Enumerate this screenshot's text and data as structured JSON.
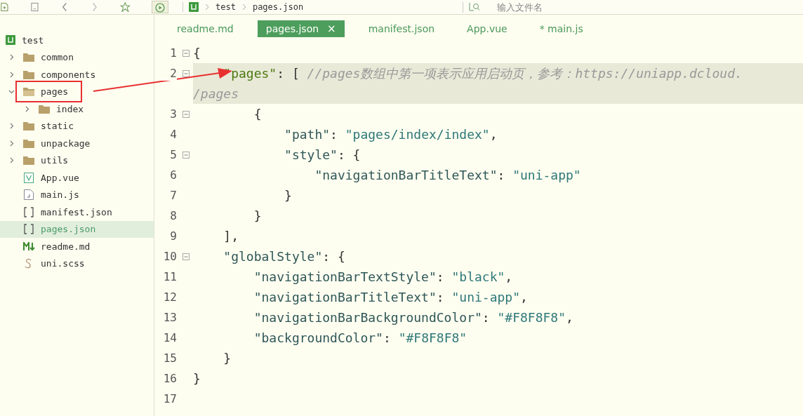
{
  "toolbar": {
    "breadcrumb": [
      "test",
      "pages.json"
    ],
    "search": {
      "placeholder": "输入文件名"
    }
  },
  "project": {
    "name": "test",
    "children": [
      {
        "name": "common",
        "kind": "folder",
        "expanded": false
      },
      {
        "name": "components",
        "kind": "folder",
        "expanded": false
      },
      {
        "name": "pages",
        "kind": "folder",
        "expanded": true,
        "highlighted": true,
        "children": [
          {
            "name": "index",
            "kind": "folder",
            "expanded": false
          }
        ]
      },
      {
        "name": "static",
        "kind": "folder",
        "expanded": false
      },
      {
        "name": "unpackage",
        "kind": "folder",
        "expanded": false
      },
      {
        "name": "utils",
        "kind": "folder",
        "expanded": false
      },
      {
        "name": "App.vue",
        "kind": "vue",
        "selected": false
      },
      {
        "name": "main.js",
        "kind": "js",
        "selected": false
      },
      {
        "name": "manifest.json",
        "kind": "json",
        "selected": false
      },
      {
        "name": "pages.json",
        "kind": "json",
        "selected": true
      },
      {
        "name": "readme.md",
        "kind": "md",
        "selected": false
      },
      {
        "name": "uni.scss",
        "kind": "scss",
        "selected": false
      }
    ]
  },
  "tabs": [
    {
      "label": "readme.md",
      "selected": false
    },
    {
      "label": "pages.json",
      "selected": true,
      "close": "×"
    },
    {
      "label": "manifest.json",
      "selected": false
    },
    {
      "label": "App.vue",
      "selected": false
    },
    {
      "label": "* main.js",
      "selected": false
    }
  ],
  "code": [
    {
      "number": "1",
      "fold": true,
      "current": false,
      "tokens": [
        {
          "kind": "punct",
          "text": "{"
        }
      ]
    },
    {
      "number": "2",
      "fold": true,
      "current": true,
      "tokens": [
        {
          "kind": "mainkey",
          "text": "    \"pages\""
        },
        {
          "kind": "punct",
          "text": ": [ "
        },
        {
          "kind": "comment",
          "text": "//pages数组中第一项表示应用启动页，参考：https://uniapp.dcloud."
        }
      ],
      "wrap": [
        {
          "kind": "comment",
          "text": "/pages"
        }
      ]
    },
    {
      "number": "3",
      "fold": true,
      "current": false,
      "tokens": [
        {
          "kind": "punct",
          "text": "        {"
        }
      ]
    },
    {
      "number": "4",
      "fold": false,
      "current": false,
      "tokens": [
        {
          "kind": "key",
          "text": "            \"path\""
        },
        {
          "kind": "punct",
          "text": ": "
        },
        {
          "kind": "string",
          "text": "\"pages/index/index\""
        },
        {
          "kind": "punct",
          "text": ","
        }
      ]
    },
    {
      "number": "5",
      "fold": true,
      "current": false,
      "tokens": [
        {
          "kind": "key",
          "text": "            \"style\""
        },
        {
          "kind": "punct",
          "text": ": {"
        }
      ]
    },
    {
      "number": "6",
      "fold": false,
      "current": false,
      "tokens": [
        {
          "kind": "key",
          "text": "                \"navigationBarTitleText\""
        },
        {
          "kind": "punct",
          "text": ": "
        },
        {
          "kind": "string",
          "text": "\"uni-app\""
        }
      ]
    },
    {
      "number": "7",
      "fold": false,
      "current": false,
      "tokens": [
        {
          "kind": "punct",
          "text": "            }"
        }
      ]
    },
    {
      "number": "8",
      "fold": false,
      "current": false,
      "tokens": [
        {
          "kind": "punct",
          "text": "        }"
        }
      ]
    },
    {
      "number": "9",
      "fold": false,
      "current": false,
      "tokens": [
        {
          "kind": "punct",
          "text": "    ],"
        }
      ]
    },
    {
      "number": "10",
      "fold": true,
      "current": false,
      "tokens": [
        {
          "kind": "key",
          "text": "    \"globalStyle\""
        },
        {
          "kind": "punct",
          "text": ": {"
        }
      ]
    },
    {
      "number": "11",
      "fold": false,
      "current": false,
      "tokens": [
        {
          "kind": "key",
          "text": "        \"navigationBarTextStyle\""
        },
        {
          "kind": "punct",
          "text": ": "
        },
        {
          "kind": "string",
          "text": "\"black\""
        },
        {
          "kind": "punct",
          "text": ","
        }
      ]
    },
    {
      "number": "12",
      "fold": false,
      "current": false,
      "tokens": [
        {
          "kind": "key",
          "text": "        \"navigationBarTitleText\""
        },
        {
          "kind": "punct",
          "text": ": "
        },
        {
          "kind": "string",
          "text": "\"uni-app\""
        },
        {
          "kind": "punct",
          "text": ","
        }
      ]
    },
    {
      "number": "13",
      "fold": false,
      "current": false,
      "tokens": [
        {
          "kind": "key",
          "text": "        \"navigationBarBackgroundColor\""
        },
        {
          "kind": "punct",
          "text": ": "
        },
        {
          "kind": "string",
          "text": "\"#F8F8F8\""
        },
        {
          "kind": "punct",
          "text": ","
        }
      ]
    },
    {
      "number": "14",
      "fold": false,
      "current": false,
      "tokens": [
        {
          "kind": "key",
          "text": "        \"backgroundColor\""
        },
        {
          "kind": "punct",
          "text": ": "
        },
        {
          "kind": "string",
          "text": "\"#F8F8F8\""
        }
      ]
    },
    {
      "number": "15",
      "fold": false,
      "current": false,
      "tokens": [
        {
          "kind": "punct",
          "text": "    }"
        }
      ]
    },
    {
      "number": "16",
      "fold": false,
      "current": false,
      "tokens": [
        {
          "kind": "punct",
          "text": "}"
        }
      ]
    },
    {
      "number": "17",
      "fold": false,
      "current": false
    }
  ]
}
